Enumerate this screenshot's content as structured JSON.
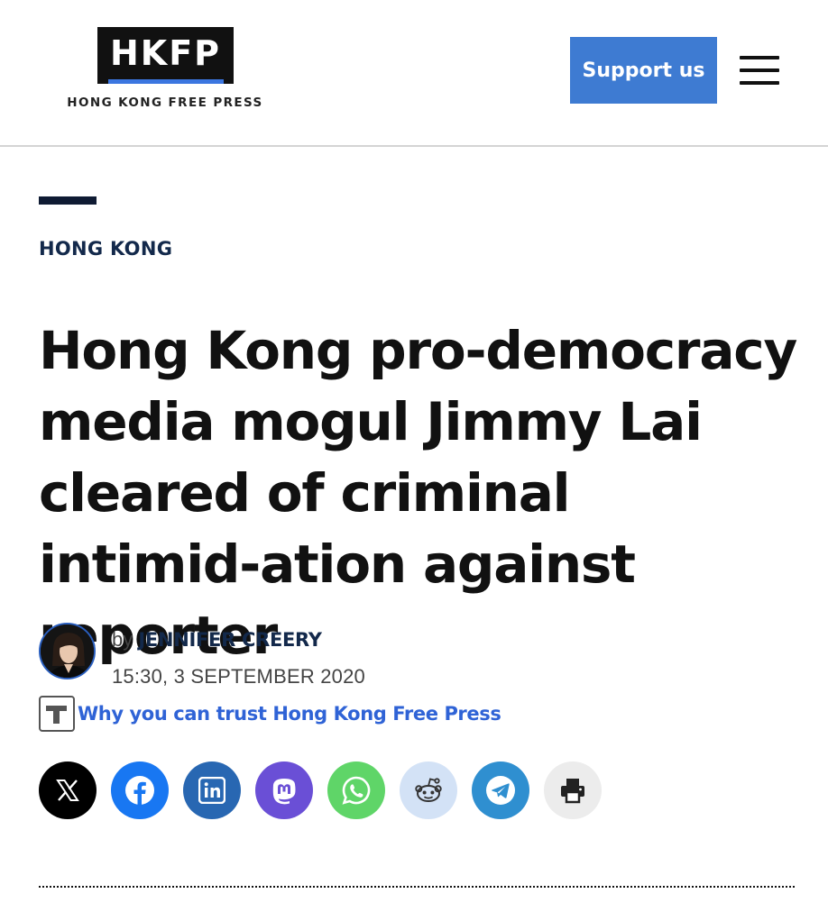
{
  "header": {
    "logo_text": "HKFP",
    "logo_tagline": "HONG KONG FREE PRESS",
    "support_label": "Support us",
    "menu_icon": "hamburger-menu-icon"
  },
  "article": {
    "category": "HONG KONG",
    "headline": "Hong Kong pro-democracy media mogul Jimmy Lai cleared of criminal intimid-ation against reporter",
    "byline_prefix": "by",
    "author": "JENNIFER CREERY",
    "date": "15:30, 3 SEPTEMBER 2020",
    "trust_link": "Why you can trust Hong Kong Free Press"
  },
  "share": [
    {
      "name": "x",
      "icon": "x-icon",
      "color": "#000000"
    },
    {
      "name": "facebook",
      "icon": "facebook-icon",
      "color": "#1877f2"
    },
    {
      "name": "linkedin",
      "icon": "linkedin-icon",
      "color": "#2867b2"
    },
    {
      "name": "mastodon",
      "icon": "mastodon-icon",
      "color": "#6a4fd6"
    },
    {
      "name": "whatsapp",
      "icon": "whatsapp-icon",
      "color": "#5fd568"
    },
    {
      "name": "reddit",
      "icon": "reddit-icon",
      "color": "#d3e2f6"
    },
    {
      "name": "telegram",
      "icon": "telegram-icon",
      "color": "#2f8fd0"
    },
    {
      "name": "print",
      "icon": "print-icon",
      "color": "#ececec"
    }
  ],
  "colors": {
    "accent": "#3e7bd2",
    "navy": "#13294b",
    "link": "#2f63d6"
  }
}
